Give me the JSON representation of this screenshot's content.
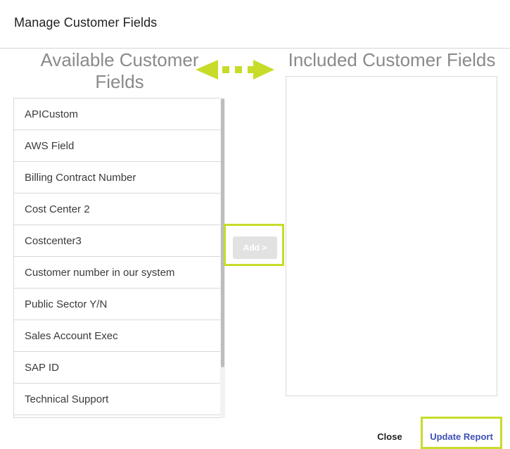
{
  "dialog": {
    "title": "Manage Customer Fields",
    "available_heading": "Available Customer Fields",
    "included_heading": "Included Customer Fields"
  },
  "available_fields": [
    "APICustom",
    "AWS Field",
    "Billing Contract Number",
    "Cost Center 2",
    "Costcenter3",
    "Customer number in our system",
    "Public Sector Y/N",
    "Sales Account Exec",
    "SAP ID",
    "Technical Support"
  ],
  "included_fields": [],
  "transfer": {
    "add_label": "Add >",
    "add_enabled": false
  },
  "footer": {
    "close_label": "Close",
    "update_label": "Update Report"
  },
  "colors": {
    "highlight": "#c7dc2a",
    "update_text": "#3f51b5",
    "heading_text": "#8a8a8a"
  },
  "icons": {
    "transfer_arrow": "double-arrow-icon"
  }
}
